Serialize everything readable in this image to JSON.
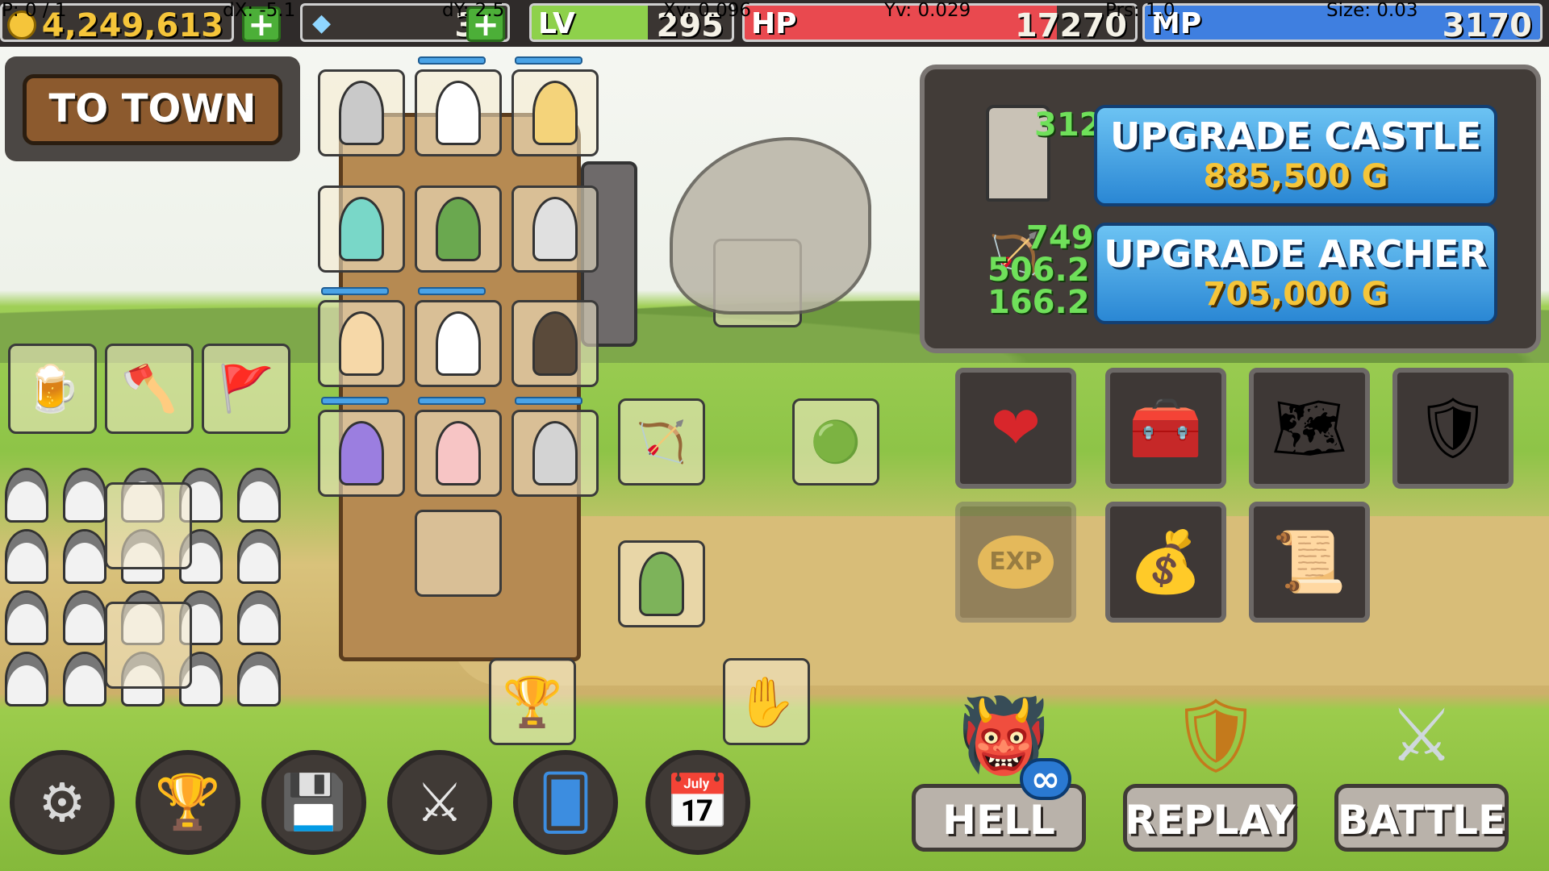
{
  "top_bar": {
    "gold": "4,249,613",
    "gems": "39",
    "level_label": "LV",
    "level": "295",
    "hp_label": "HP",
    "hp": "17270",
    "mp_label": "MP",
    "mp": "3170",
    "plus_symbol": "+",
    "level_progress": 0.58,
    "hp_fraction": 0.8
  },
  "debug": {
    "p": "P: 0 / 1",
    "dx": "dX: -5.1",
    "dy": "dY: 2.5",
    "xv": "Xv: 0.096",
    "yv": "Yv: 0.029",
    "prs": "Prs: 1.0",
    "size": "Size: 0.03"
  },
  "town_button": "TO TOWN",
  "upgrade_panel": {
    "castle_level": "312",
    "castle_title": "UPGRADE CASTLE",
    "castle_cost": "885,500 G",
    "archer_level": "749",
    "archer_stat1": "506.2",
    "archer_stat2": "166.2",
    "archer_title": "UPGRADE ARCHER",
    "archer_cost": "705,000 G"
  },
  "items": [
    {
      "icon": "heart-arrow-icon"
    },
    {
      "icon": "treasure-chest-icon"
    },
    {
      "icon": "map-scroll-icon"
    },
    {
      "icon": "leaf-shield-banner-icon"
    },
    {
      "icon": "exp-fire-icon",
      "label": "EXP"
    },
    {
      "icon": "money-bag-icon"
    },
    {
      "icon": "map-leaf-icon"
    }
  ],
  "bottom_buttons": [
    "gear-icon",
    "trophy-icon",
    "floppy-disk-icon",
    "crossed-swords-icon",
    "cards-icon",
    "calendar-alert-icon"
  ],
  "modes": {
    "hell": "HELL",
    "replay": "REPLAY",
    "battle": "BATTLE",
    "infinity_symbol": "∞"
  },
  "colors": {
    "gold": "#f5c53a",
    "level_bar": "#8ed14b",
    "hp_bar": "#e9494f",
    "mp_bar": "#3f7fe0",
    "upgrade_button": "#2a87d4",
    "stat_green": "#6fe05a"
  }
}
